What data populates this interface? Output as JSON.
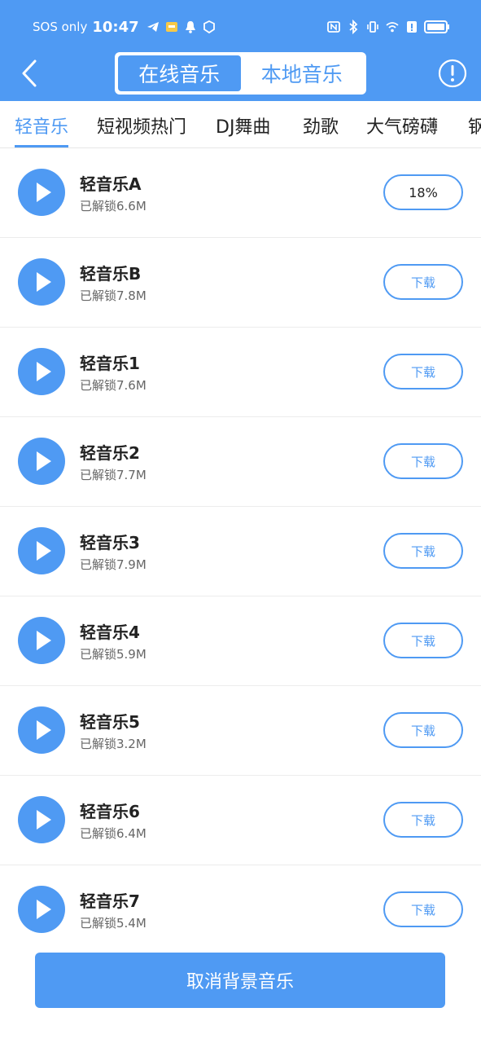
{
  "status_bar": {
    "carrier": "SOS only",
    "time": "10:47"
  },
  "header": {
    "segments": [
      {
        "label": "在线音乐",
        "active": true
      },
      {
        "label": "本地音乐",
        "active": false
      }
    ]
  },
  "tabs": [
    {
      "label": "轻音乐",
      "active": true
    },
    {
      "label": "短视频热门",
      "active": false
    },
    {
      "label": "DJ舞曲",
      "active": false
    },
    {
      "label": "劲歌",
      "active": false
    },
    {
      "label": "大气磅礴",
      "active": false
    },
    {
      "label": "钢",
      "active": false
    }
  ],
  "tracks": [
    {
      "title": "轻音乐A",
      "size": "已解锁6.6M",
      "action": "18%"
    },
    {
      "title": "轻音乐B",
      "size": "已解锁7.8M",
      "action": "下载"
    },
    {
      "title": "轻音乐1",
      "size": "已解锁7.6M",
      "action": "下载"
    },
    {
      "title": "轻音乐2",
      "size": "已解锁7.7M",
      "action": "下载"
    },
    {
      "title": "轻音乐3",
      "size": "已解锁7.9M",
      "action": "下载"
    },
    {
      "title": "轻音乐4",
      "size": "已解锁5.9M",
      "action": "下载"
    },
    {
      "title": "轻音乐5",
      "size": "已解锁3.2M",
      "action": "下载"
    },
    {
      "title": "轻音乐6",
      "size": "已解锁6.4M",
      "action": "下载"
    },
    {
      "title": "轻音乐7",
      "size": "已解锁5.4M",
      "action": "下载"
    }
  ],
  "footer": {
    "cancel_label": "取消背景音乐"
  },
  "colors": {
    "accent": "#4f9af3"
  }
}
